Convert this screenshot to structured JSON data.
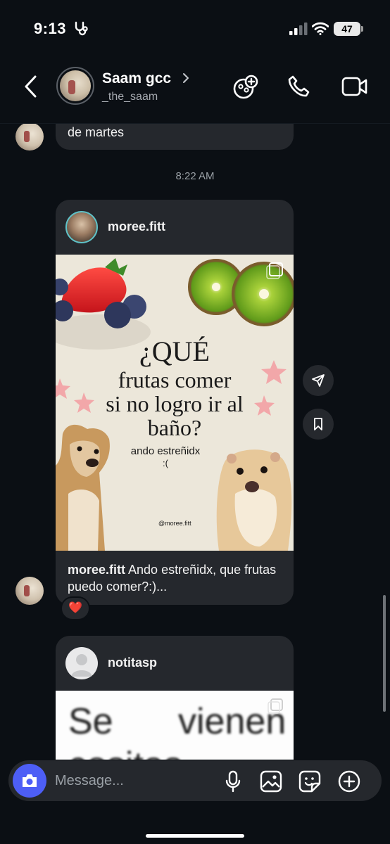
{
  "status_bar": {
    "time": "9:13",
    "battery": "47",
    "icons": [
      "stethoscope-icon",
      "signal-icon",
      "wifi-icon",
      "battery-icon"
    ]
  },
  "header": {
    "name": "Saam gcc",
    "username": "_the_saam",
    "icons": [
      "back-chevron-icon",
      "chevron-right-icon",
      "add-people-icon",
      "phone-icon",
      "video-icon"
    ]
  },
  "messages": {
    "partial_text": "de martes",
    "timestamp": "8:22 AM",
    "reaction": "❤️"
  },
  "post1": {
    "username": "moree.fitt",
    "image": {
      "headline": "¿QUÉ",
      "line2": "frutas comer",
      "line3": "si no logro ir al",
      "line4": "baño?",
      "sub1": "ando estreñidx",
      "sub2": ":(",
      "handle": "@moree.fitt"
    },
    "caption_user": "moree.fitt",
    "caption_text": " Ando estreñidx, que frutas puedo comer?:)..."
  },
  "post2": {
    "username": "notitasp",
    "image_text_1": "Se",
    "image_text_2": "vienen",
    "image_text_3": "cositas"
  },
  "composer": {
    "placeholder": "Message...",
    "icons": [
      "camera-icon",
      "microphone-icon",
      "gallery-icon",
      "sticker-icon",
      "plus-icon"
    ]
  },
  "colors": {
    "background": "#0b0f14",
    "bubble": "#25282d",
    "accent": "#4d5ef6"
  }
}
